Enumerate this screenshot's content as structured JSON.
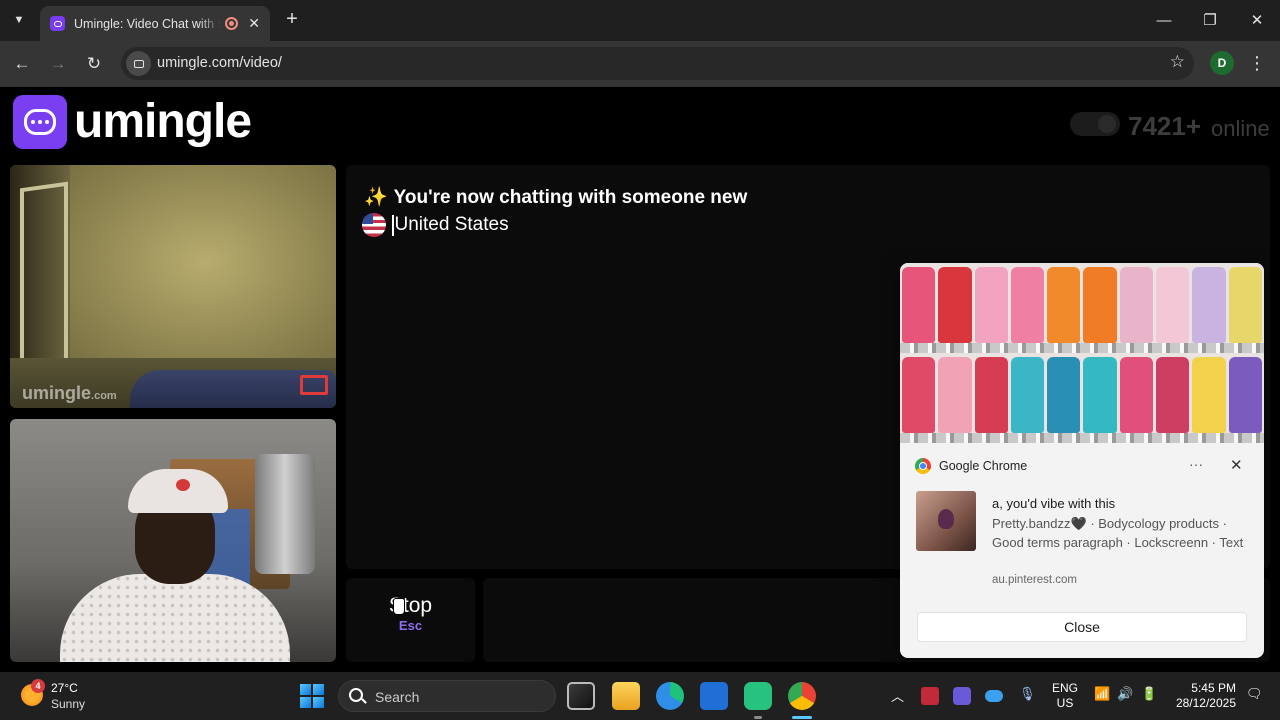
{
  "browser": {
    "tab_title": "Umingle: Video Chat with St",
    "url": "umingle.com/video/",
    "profile_initial": "D"
  },
  "site": {
    "logo_text": "umingle",
    "online_count": "7421+",
    "online_label": "online"
  },
  "remote_video": {
    "watermark": "umingle",
    "watermark_suffix": ".com"
  },
  "chat": {
    "system_message": "You're now chatting with someone new",
    "spark_icon": "✨",
    "country": "United States"
  },
  "controls": {
    "stop_label": "Stop",
    "stop_key": "Esc"
  },
  "notification": {
    "app_name": "Google Chrome",
    "title": "a, you'd vibe with this",
    "body": "Pretty.bandzz🖤 · Bodycology products · Good terms paragraph · Lockscreenn · Text",
    "source": "au.pinterest.com",
    "close_label": "Close",
    "more_icon": "···",
    "close_icon": "✕"
  },
  "taskbar": {
    "weather_temp": "27°C",
    "weather_condition": "Sunny",
    "weather_badge": "4",
    "search_placeholder": "Search",
    "lang_line1": "ENG",
    "lang_line2": "US",
    "time": "5:45 PM",
    "date": "28/12/2025"
  },
  "colors": {
    "brand": "#7b3ff2",
    "stop_key": "#8f6cf0"
  }
}
